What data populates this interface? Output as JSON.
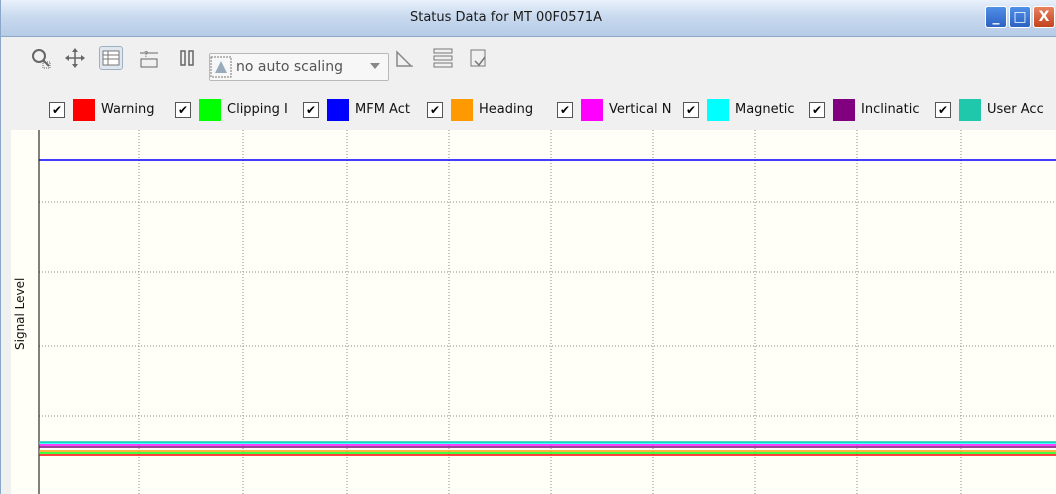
{
  "window": {
    "title": "Status Data for MT 00F0571A",
    "buttons": [
      "_",
      "□",
      "X"
    ]
  },
  "toolbar": {
    "icons": [
      "zoom-icon",
      "pan-icon",
      "table-icon",
      "scale-icon",
      "pause-icon",
      "autoscale-icon",
      "ruler-icon",
      "layout-icon",
      "export-icon"
    ],
    "scaling_value": "no auto scaling"
  },
  "legend": {
    "items": [
      {
        "label": "Warning",
        "color": "#ff0000",
        "checked": "✔"
      },
      {
        "label": "Clipping I",
        "color": "#00ff00",
        "checked": "✔"
      },
      {
        "label": "MFM Act",
        "color": "#0000ff",
        "checked": "✔"
      },
      {
        "label": "Heading",
        "color": "#ff9900",
        "checked": "✔"
      },
      {
        "label": "Vertical N",
        "color": "#ff00ff",
        "checked": "✔"
      },
      {
        "label": "Magnetic",
        "color": "#00ffff",
        "checked": "✔"
      },
      {
        "label": "Inclinatic",
        "color": "#800080",
        "checked": "✔"
      },
      {
        "label": "User Acc",
        "color": "#1fc8aa",
        "checked": "✔"
      }
    ]
  },
  "chart": {
    "ylabel": "Signal Level"
  }
}
